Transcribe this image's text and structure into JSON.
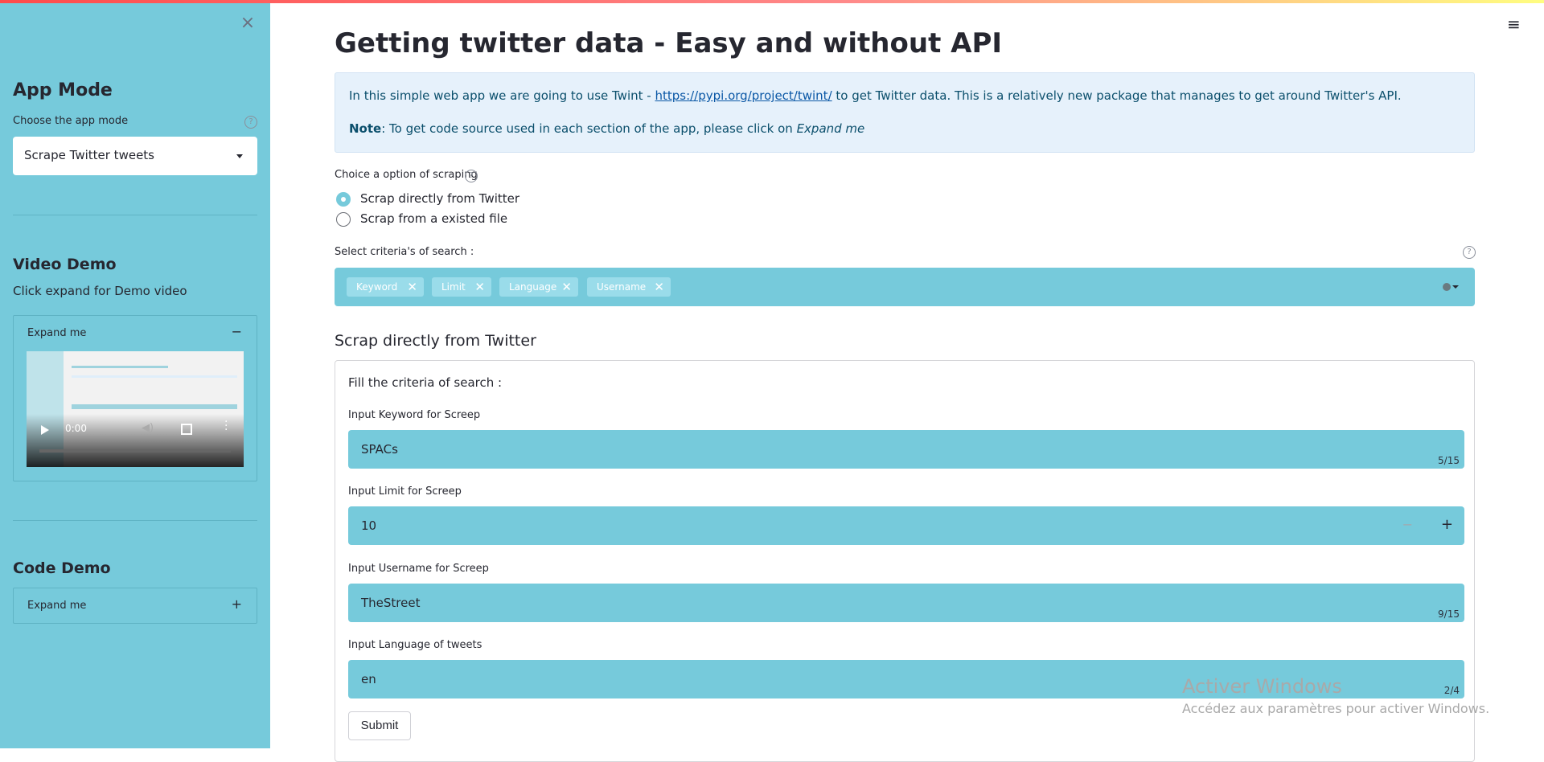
{
  "sidebar": {
    "close_glyph": "×",
    "app_mode": {
      "title": "App Mode",
      "select_label": "Choose the app mode",
      "selected": "Scrape Twitter tweets"
    },
    "video_demo": {
      "title": "Video Demo",
      "text": "Click expand for Demo video",
      "expander_label": "Expand me",
      "expander_state_glyph": "−",
      "video": {
        "time": "0:00"
      }
    },
    "code_demo": {
      "title": "Code Demo",
      "expander_label": "Expand me",
      "expander_state_glyph": "+"
    },
    "help_glyph": "?"
  },
  "main": {
    "title": "Getting twitter data - Easy and without API",
    "info": {
      "line1_pre": "In this simple web app we are going to use Twint - ",
      "line1_link": "https://pypi.org/project/twint/",
      "line1_post": " to get Twitter data. This is a relatively new package that manages to get around Twitter's API.",
      "line2_bold": "Note",
      "line2_text": ": To get code source used in each section of the app, please click on ",
      "line2_italic": "Expand me"
    },
    "scrape_option": {
      "label": "Choice a option of scraping",
      "options": [
        "Scrap directly from Twitter",
        "Scrap from a existed file"
      ],
      "selected_index": 0
    },
    "criteria": {
      "label": "Select criteria's of search :",
      "tags": [
        "Keyword",
        "Limit",
        "Language",
        "Username"
      ],
      "remove_glyph": "✕"
    },
    "section_title": "Scrap directly from Twitter",
    "form": {
      "heading": "Fill the criteria of search :",
      "keyword": {
        "label": "Input Keyword for Screep",
        "value": "SPACs",
        "count": "5/15"
      },
      "limit": {
        "label": "Input Limit for Screep",
        "value": "10",
        "minus": "−",
        "plus": "+"
      },
      "username": {
        "label": "Input Username for Screep",
        "value": "TheStreet",
        "count": "9/15"
      },
      "language": {
        "label": "Input Language of tweets",
        "value": "en",
        "count": "2/4"
      },
      "submit": "Submit"
    }
  },
  "menu_glyph": "≡",
  "watermark": {
    "line1": "Activer Windows",
    "line2": "Accédez aux paramètres pour activer Windows."
  },
  "colors": {
    "sidebar": "#76cadb",
    "widget": "#76cadb",
    "info_bg": "#e6f1fb",
    "tag_bg": "#9adcea"
  }
}
